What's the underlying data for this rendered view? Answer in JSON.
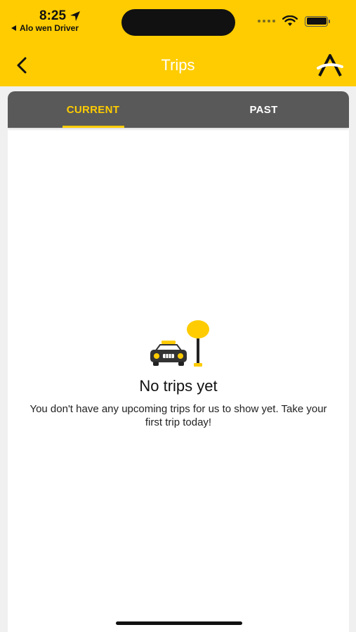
{
  "status_bar": {
    "time": "8:25",
    "back_app": "Alo wen Driver",
    "location_icon": "location-arrow-icon",
    "wifi_icon": "wifi-icon",
    "battery_icon": "battery-icon"
  },
  "header": {
    "title": "Trips",
    "back_icon": "chevron-left-icon",
    "logo": "app-logo-icon"
  },
  "tabs": [
    {
      "label": "CURRENT",
      "active": true
    },
    {
      "label": "PAST",
      "active": false
    }
  ],
  "empty_state": {
    "illustration": "taxi-stop-illustration",
    "title": "No trips yet",
    "message": "You don't have any upcoming trips for us to show yet. Take your first trip today!"
  },
  "colors": {
    "brand_yellow": "#fecc01",
    "tab_bar": "#595959",
    "background": "#f0f0f0"
  }
}
